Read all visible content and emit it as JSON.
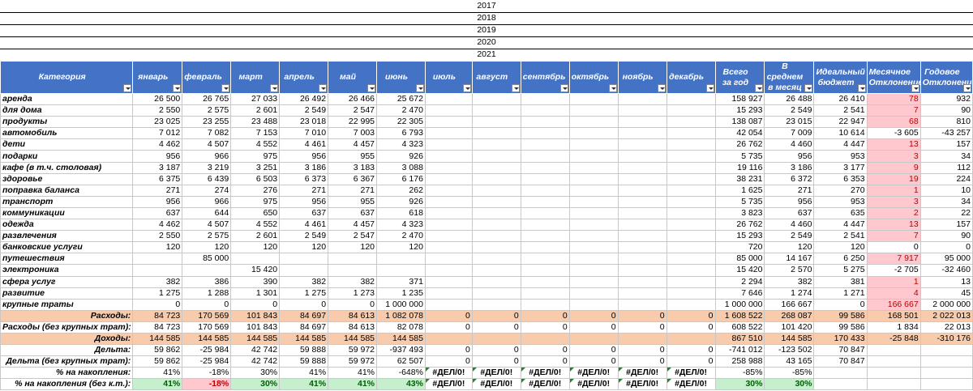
{
  "years": [
    "2017",
    "2018",
    "2019",
    "2020",
    "2021"
  ],
  "headers": [
    {
      "label": "Категория",
      "key": "category"
    },
    {
      "label": "январь",
      "key": "jan"
    },
    {
      "label": "февраль",
      "key": "feb"
    },
    {
      "label": "март",
      "key": "mar"
    },
    {
      "label": "апрель",
      "key": "apr"
    },
    {
      "label": "май",
      "key": "may"
    },
    {
      "label": "июнь",
      "key": "jun"
    },
    {
      "label": "июль",
      "key": "jul"
    },
    {
      "label": "август",
      "key": "aug"
    },
    {
      "label": "сентябрь",
      "key": "sep"
    },
    {
      "label": "октябрь",
      "key": "oct"
    },
    {
      "label": "ноябрь",
      "key": "nov"
    },
    {
      "label": "декабрь",
      "key": "dec"
    },
    {
      "label": "Всего за год",
      "key": "total"
    },
    {
      "label": "В среднем в месяц",
      "key": "avg"
    },
    {
      "label": "Идеальный бюджет",
      "key": "ideal"
    },
    {
      "label": "Месячное Отклонение",
      "key": "mdev"
    },
    {
      "label": "Годовое Отклонение",
      "key": "ydev"
    }
  ],
  "rows": [
    [
      "аренда",
      "26 500",
      "26 765",
      "27 033",
      "26 492",
      "26 466",
      "25 672",
      "",
      "",
      "",
      "",
      "",
      "",
      "158 927",
      "26 488",
      "26 410",
      "78",
      "932"
    ],
    [
      "для дома",
      "2 550",
      "2 575",
      "2 601",
      "2 549",
      "2 547",
      "2 470",
      "",
      "",
      "",
      "",
      "",
      "",
      "15 293",
      "2 549",
      "2 541",
      "7",
      "90"
    ],
    [
      "продукты",
      "23 025",
      "23 255",
      "23 488",
      "23 018",
      "22 995",
      "22 305",
      "",
      "",
      "",
      "",
      "",
      "",
      "138 087",
      "23 015",
      "22 947",
      "68",
      "810"
    ],
    [
      "автомобиль",
      "7 012",
      "7 082",
      "7 153",
      "7 010",
      "7 003",
      "6 793",
      "",
      "",
      "",
      "",
      "",
      "",
      "42 054",
      "7 009",
      "10 614",
      "-3 605",
      "-43 257"
    ],
    [
      "дети",
      "4 462",
      "4 507",
      "4 552",
      "4 461",
      "4 457",
      "4 323",
      "",
      "",
      "",
      "",
      "",
      "",
      "26 762",
      "4 460",
      "4 447",
      "13",
      "157"
    ],
    [
      "подарки",
      "956",
      "966",
      "975",
      "956",
      "955",
      "926",
      "",
      "",
      "",
      "",
      "",
      "",
      "5 735",
      "956",
      "953",
      "3",
      "34"
    ],
    [
      "кафе (в т.ч. столовая)",
      "3 187",
      "3 219",
      "3 251",
      "3 186",
      "3 183",
      "3 088",
      "",
      "",
      "",
      "",
      "",
      "",
      "19 116",
      "3 186",
      "3 177",
      "9",
      "112"
    ],
    [
      "здоровье",
      "6 375",
      "6 439",
      "6 503",
      "6 373",
      "6 367",
      "6 176",
      "",
      "",
      "",
      "",
      "",
      "",
      "38 231",
      "6 372",
      "6 353",
      "19",
      "224"
    ],
    [
      "поправка баланса",
      "271",
      "274",
      "276",
      "271",
      "271",
      "262",
      "",
      "",
      "",
      "",
      "",
      "",
      "1 625",
      "271",
      "270",
      "1",
      "10"
    ],
    [
      "транспорт",
      "956",
      "966",
      "975",
      "956",
      "955",
      "926",
      "",
      "",
      "",
      "",
      "",
      "",
      "5 735",
      "956",
      "953",
      "3",
      "34"
    ],
    [
      "коммуникации",
      "637",
      "644",
      "650",
      "637",
      "637",
      "618",
      "",
      "",
      "",
      "",
      "",
      "",
      "3 823",
      "637",
      "635",
      "2",
      "22"
    ],
    [
      "одежда",
      "4 462",
      "4 507",
      "4 552",
      "4 461",
      "4 457",
      "4 323",
      "",
      "",
      "",
      "",
      "",
      "",
      "26 762",
      "4 460",
      "4 447",
      "13",
      "157"
    ],
    [
      "развлечения",
      "2 550",
      "2 575",
      "2 601",
      "2 549",
      "2 547",
      "2 470",
      "",
      "",
      "",
      "",
      "",
      "",
      "15 293",
      "2 549",
      "2 541",
      "7",
      "90"
    ],
    [
      "банковские услуги",
      "120",
      "120",
      "120",
      "120",
      "120",
      "120",
      "",
      "",
      "",
      "",
      "",
      "",
      "720",
      "120",
      "120",
      "0",
      "0"
    ],
    [
      "путешествия",
      "",
      "85 000",
      "",
      "",
      "",
      "",
      "",
      "",
      "",
      "",
      "",
      "",
      "85 000",
      "14 167",
      "6 250",
      "7 917",
      "95 000"
    ],
    [
      "электроника",
      "",
      "",
      "15 420",
      "",
      "",
      "",
      "",
      "",
      "",
      "",
      "",
      "",
      "15 420",
      "2 570",
      "5 275",
      "-2 705",
      "-32 460"
    ],
    [
      "сфера услуг",
      "382",
      "386",
      "390",
      "382",
      "382",
      "371",
      "",
      "",
      "",
      "",
      "",
      "",
      "2 294",
      "382",
      "381",
      "1",
      "13"
    ],
    [
      "развитие",
      "1 275",
      "1 288",
      "1 301",
      "1 275",
      "1 273",
      "1 235",
      "",
      "",
      "",
      "",
      "",
      "",
      "7 646",
      "1 274",
      "1 271",
      "4",
      "45"
    ],
    [
      "крупные траты",
      "0",
      "0",
      "0",
      "0",
      "0",
      "1 000 000",
      "",
      "",
      "",
      "",
      "",
      "",
      "1 000 000",
      "166 667",
      "0",
      "166 667",
      "2 000 000"
    ]
  ],
  "pink_cells": [
    [
      0,
      16
    ],
    [
      1,
      16
    ],
    [
      2,
      16
    ],
    [
      4,
      16
    ],
    [
      5,
      16
    ],
    [
      6,
      16
    ],
    [
      7,
      16
    ],
    [
      8,
      16
    ],
    [
      9,
      16
    ],
    [
      10,
      16
    ],
    [
      11,
      16
    ],
    [
      12,
      16
    ],
    [
      14,
      16
    ],
    [
      16,
      16
    ],
    [
      17,
      16
    ],
    [
      18,
      16
    ]
  ],
  "summary": [
    {
      "label": "Расходы:",
      "style": "peach",
      "cells": [
        "84 723",
        "170 569",
        "101 843",
        "84 697",
        "84 613",
        "1 082 078",
        "0",
        "0",
        "0",
        "0",
        "0",
        "0",
        "1 608 522",
        "268 087",
        "99 586",
        "168 501",
        "2 022 013"
      ]
    },
    {
      "label": "Расходы (без крупных трат):",
      "style": "plain",
      "cells": [
        "84 723",
        "170 569",
        "101 843",
        "84 697",
        "84 613",
        "82 078",
        "0",
        "0",
        "0",
        "0",
        "0",
        "0",
        "608 522",
        "101 420",
        "99 586",
        "1 834",
        "22 013"
      ]
    },
    {
      "label": "Доходы:",
      "style": "peach",
      "cells": [
        "144 585",
        "144 585",
        "144 585",
        "144 585",
        "144 585",
        "144 585",
        "",
        "",
        "",
        "",
        "",
        "",
        "867 510",
        "144 585",
        "170 433",
        "-25 848",
        "-310 176"
      ]
    },
    {
      "label": "Дельта:",
      "style": "plain",
      "cells": [
        "59 862",
        "-25 984",
        "42 742",
        "59 888",
        "59 972",
        "-937 493",
        "0",
        "0",
        "0",
        "0",
        "0",
        "0",
        "-741 012",
        "-123 502",
        "70 847",
        "",
        ""
      ]
    },
    {
      "label": "Дельта (без крупных трат):",
      "style": "plain",
      "cells": [
        "59 862",
        "-25 984",
        "42 742",
        "59 888",
        "59 972",
        "62 507",
        "0",
        "0",
        "0",
        "0",
        "0",
        "0",
        "258 988",
        "43 165",
        "70 847",
        "",
        ""
      ]
    },
    {
      "label": "% на накопления:",
      "style": "plain",
      "cells": [
        "41%",
        "-18%",
        "30%",
        "41%",
        "41%",
        "-648%",
        "#ДЕЛ/0!",
        "#ДЕЛ/0!",
        "#ДЕЛ/0!",
        "#ДЕЛ/0!",
        "#ДЕЛ/0!",
        "#ДЕЛ/0!",
        "-85%",
        "-85%",
        "",
        "",
        ""
      ]
    },
    {
      "label": "% на накопления (без к.т.):",
      "style": "bold",
      "cells": [
        "41%",
        "-18%",
        "30%",
        "41%",
        "41%",
        "43%",
        "#ДЕЛ/0!",
        "#ДЕЛ/0!",
        "#ДЕЛ/0!",
        "#ДЕЛ/0!",
        "#ДЕЛ/0!",
        "#ДЕЛ/0!",
        "30%",
        "30%",
        "",
        "",
        ""
      ]
    }
  ],
  "colors": {
    "header": "#4472c4",
    "peach": "#f8cbad",
    "pink": "#ffc7ce",
    "green": "#c6efce"
  }
}
